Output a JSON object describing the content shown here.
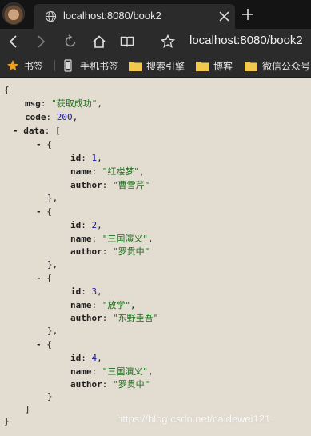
{
  "browser": {
    "tab_title": "localhost:8080/book2",
    "address": "localhost:8080/book2"
  },
  "bookmarks": {
    "items": [
      "书签",
      "手机书签",
      "搜索引擎",
      "博客",
      "微信公众号"
    ]
  },
  "json_view": {
    "msg_key": "msg",
    "msg_value": "\"获取成功\"",
    "code_key": "code",
    "code_value": "200",
    "data_key": "data",
    "books": [
      {
        "id_key": "id",
        "id": "1",
        "name_key": "name",
        "name": "\"红楼梦\"",
        "author_key": "author",
        "author": "\"曹雪芹\""
      },
      {
        "id_key": "id",
        "id": "2",
        "name_key": "name",
        "name": "\"三国演义\"",
        "author_key": "author",
        "author": "\"罗贯中\""
      },
      {
        "id_key": "id",
        "id": "3",
        "name_key": "name",
        "name": "\"放学\"",
        "author_key": "author",
        "author": "\"东野圭吾\""
      },
      {
        "id_key": "id",
        "id": "4",
        "name_key": "name",
        "name": "\"三国演义\"",
        "author_key": "author",
        "author": "\"罗贯中\""
      }
    ]
  },
  "watermark": "https://blog.csdn.net/caidewei121"
}
